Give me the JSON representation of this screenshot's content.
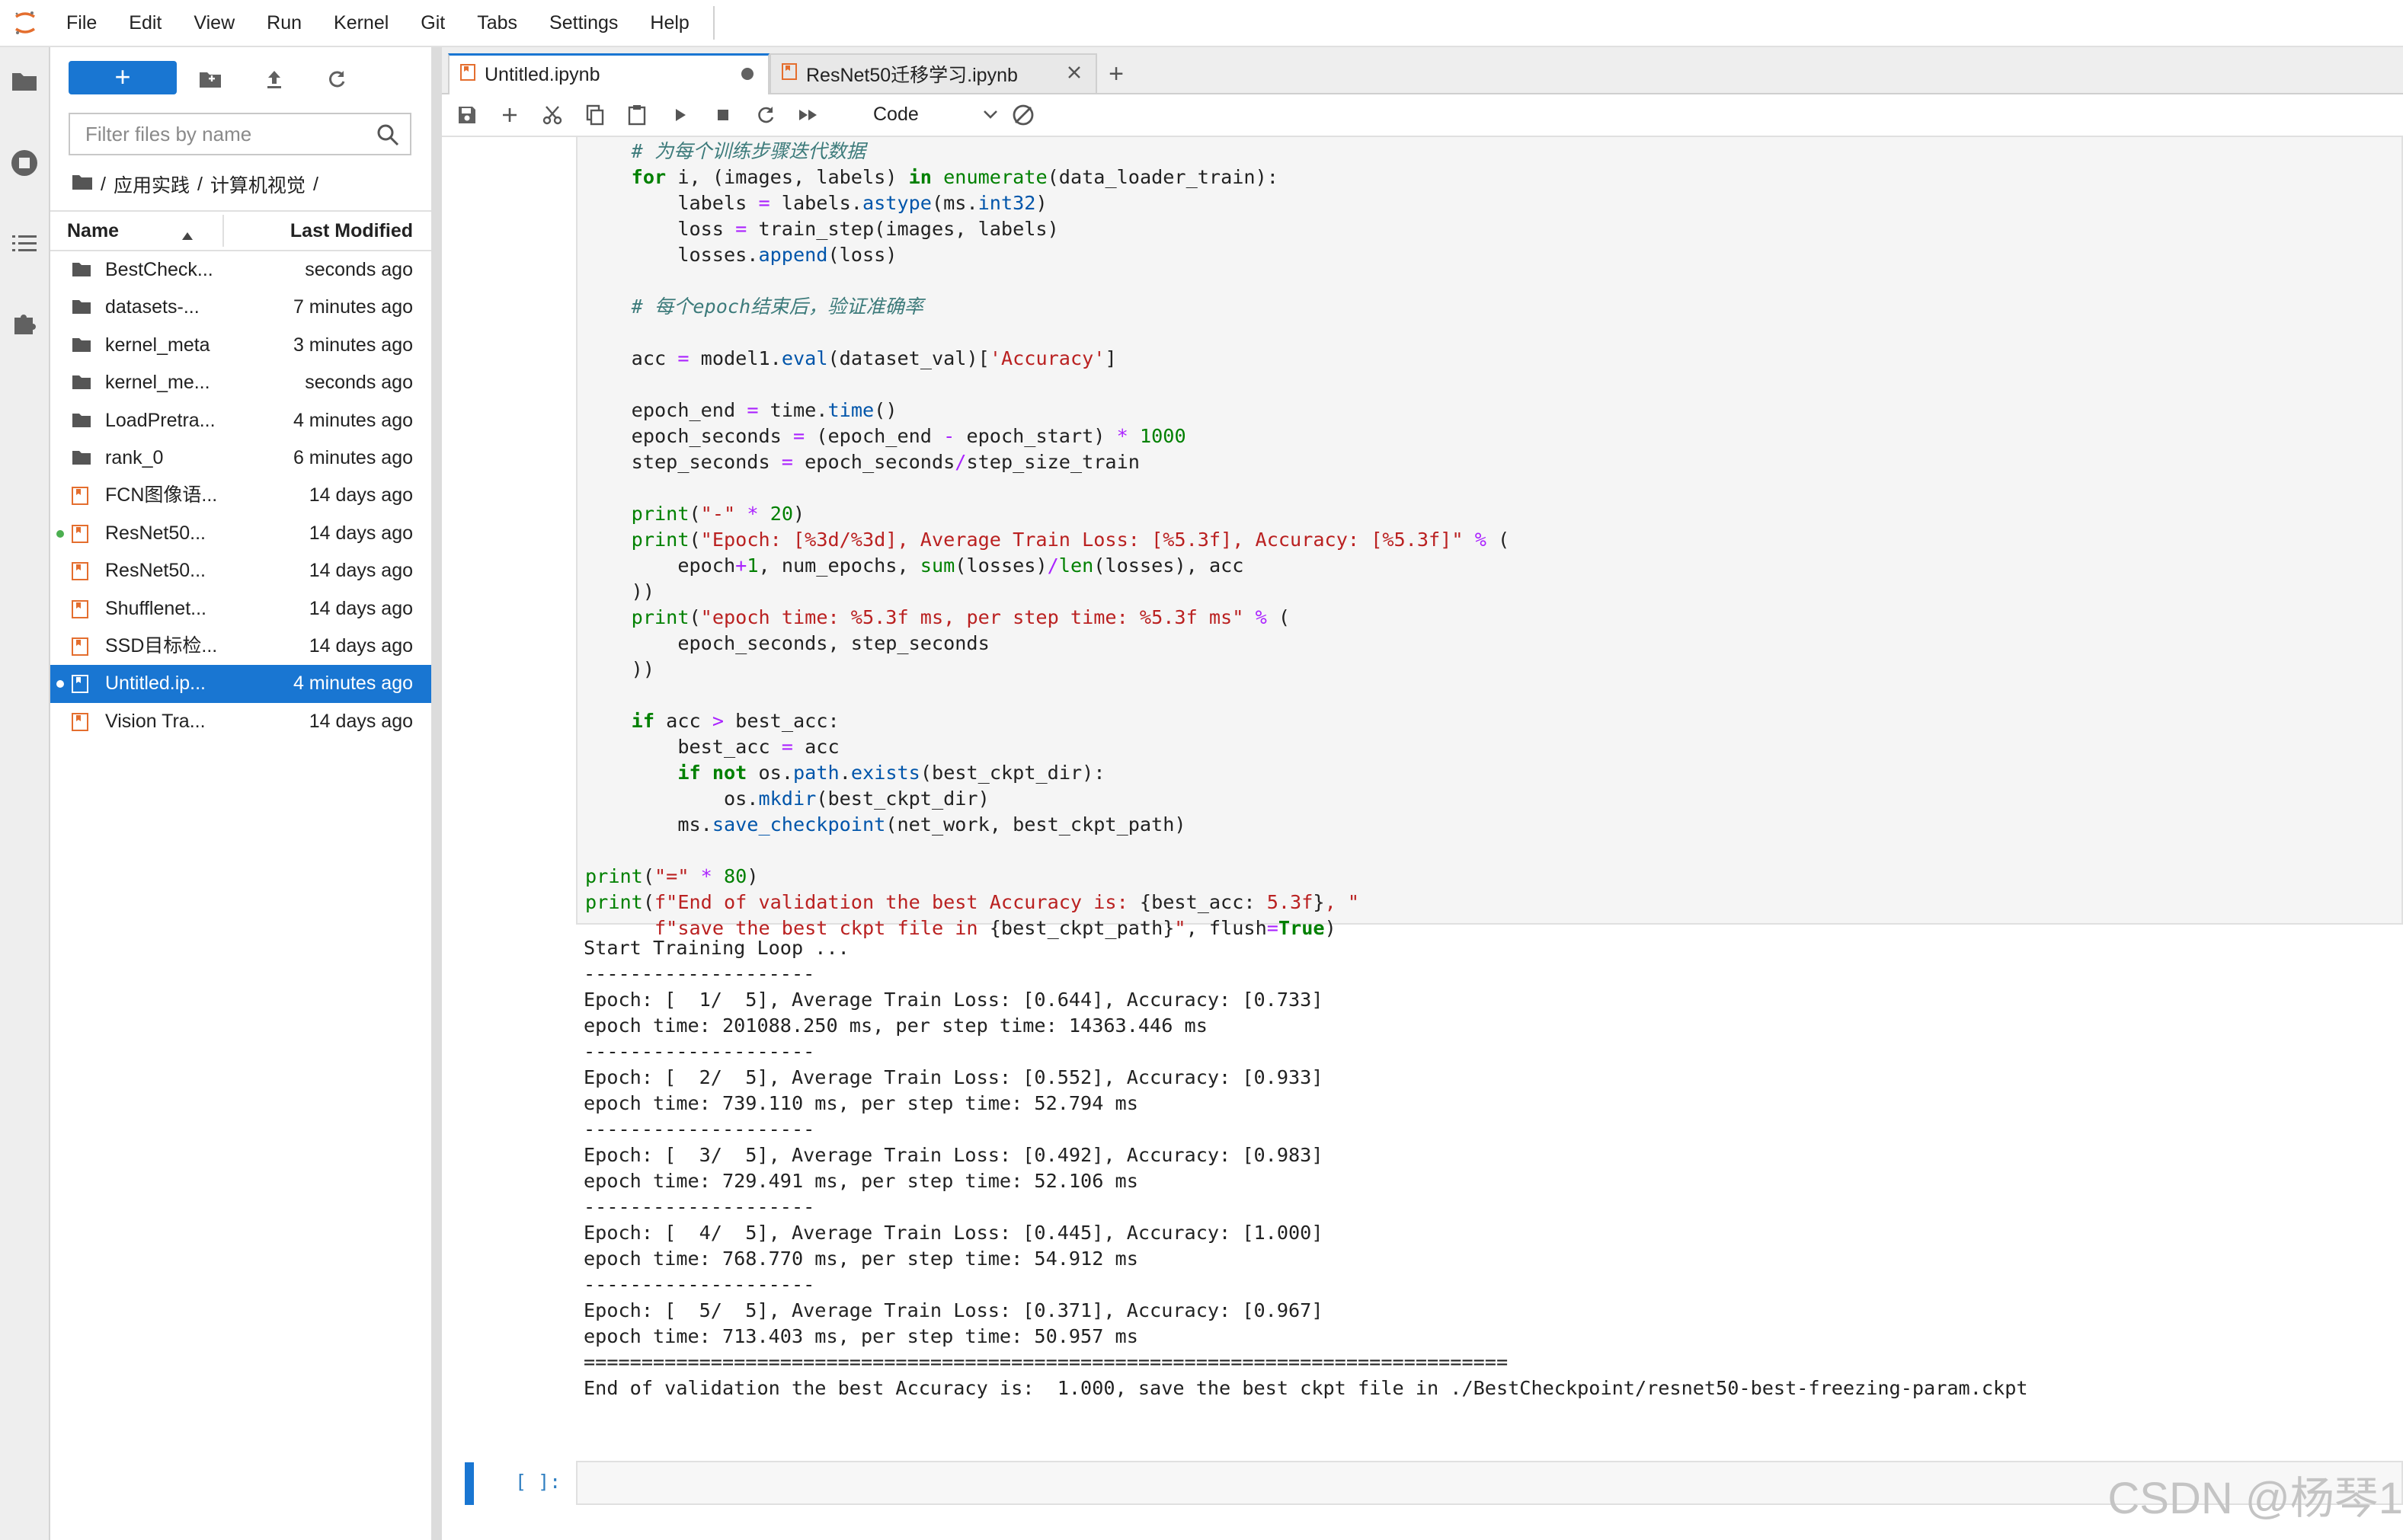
{
  "menu": [
    "File",
    "Edit",
    "View",
    "Run",
    "Kernel",
    "Git",
    "Tabs",
    "Settings",
    "Help"
  ],
  "file_browser": {
    "new_button_label": "+",
    "filter_placeholder": "Filter files by name",
    "breadcrumb": [
      "/",
      "应用实践",
      "/",
      "计算机视觉",
      "/"
    ],
    "columns": {
      "name": "Name",
      "modified": "Last Modified"
    },
    "items": [
      {
        "name": "BestCheck...",
        "modified": "seconds ago",
        "type": "folder",
        "running": false,
        "selected": false
      },
      {
        "name": "datasets-...",
        "modified": "7 minutes ago",
        "type": "folder",
        "running": false,
        "selected": false
      },
      {
        "name": "kernel_meta",
        "modified": "3 minutes ago",
        "type": "folder",
        "running": false,
        "selected": false
      },
      {
        "name": "kernel_me...",
        "modified": "seconds ago",
        "type": "folder",
        "running": false,
        "selected": false
      },
      {
        "name": "LoadPretra...",
        "modified": "4 minutes ago",
        "type": "folder",
        "running": false,
        "selected": false
      },
      {
        "name": "rank_0",
        "modified": "6 minutes ago",
        "type": "folder",
        "running": false,
        "selected": false
      },
      {
        "name": "FCN图像语...",
        "modified": "14 days ago",
        "type": "notebook",
        "running": false,
        "selected": false
      },
      {
        "name": "ResNet50...",
        "modified": "14 days ago",
        "type": "notebook",
        "running": true,
        "selected": false
      },
      {
        "name": "ResNet50...",
        "modified": "14 days ago",
        "type": "notebook",
        "running": false,
        "selected": false
      },
      {
        "name": "Shufflenet...",
        "modified": "14 days ago",
        "type": "notebook",
        "running": false,
        "selected": false
      },
      {
        "name": "SSD目标检...",
        "modified": "14 days ago",
        "type": "notebook",
        "running": false,
        "selected": false
      },
      {
        "name": "Untitled.ip...",
        "modified": "4 minutes ago",
        "type": "notebook",
        "running": true,
        "selected": true
      },
      {
        "name": "Vision Tra...",
        "modified": "14 days ago",
        "type": "notebook",
        "running": false,
        "selected": false
      }
    ]
  },
  "tabs": [
    {
      "label": "Untitled.ipynb",
      "active": true,
      "unsaved": true
    },
    {
      "label": "ResNet50迁移学习.ipynb",
      "active": false,
      "unsaved": false
    }
  ],
  "tab_add_label": "+",
  "toolbar": {
    "cell_type": "Code"
  },
  "code_lines": [
    [
      [
        "    ",
        ""
      ],
      [
        "# 为每个训练步骤迭代数据",
        "cm"
      ]
    ],
    [
      [
        "    ",
        ""
      ],
      [
        "for",
        "kw"
      ],
      [
        " i, (images, labels) ",
        ""
      ],
      [
        "in",
        "kw"
      ],
      [
        " ",
        ""
      ],
      [
        "enumerate",
        "bi"
      ],
      [
        "(data_loader_train):",
        ""
      ]
    ],
    [
      [
        "        labels ",
        ""
      ],
      [
        "=",
        "op"
      ],
      [
        " labels.",
        ""
      ],
      [
        "astype",
        "fn"
      ],
      [
        "(ms.",
        ""
      ],
      [
        "int32",
        "fn"
      ],
      [
        ")",
        ""
      ]
    ],
    [
      [
        "        loss ",
        ""
      ],
      [
        "=",
        "op"
      ],
      [
        " train_step(images, labels)",
        ""
      ]
    ],
    [
      [
        "        losses.",
        ""
      ],
      [
        "append",
        "fn"
      ],
      [
        "(loss)",
        ""
      ]
    ],
    [
      [
        "",
        ""
      ]
    ],
    [
      [
        "    ",
        ""
      ],
      [
        "# 每个epoch结束后，验证准确率",
        "cm"
      ]
    ],
    [
      [
        "",
        ""
      ]
    ],
    [
      [
        "    acc ",
        ""
      ],
      [
        "=",
        "op"
      ],
      [
        " model1.",
        ""
      ],
      [
        "eval",
        "fn"
      ],
      [
        "(dataset_val)[",
        ""
      ],
      [
        "'Accuracy'",
        "st"
      ],
      [
        "]",
        ""
      ]
    ],
    [
      [
        "",
        ""
      ]
    ],
    [
      [
        "    epoch_end ",
        ""
      ],
      [
        "=",
        "op"
      ],
      [
        " time.",
        ""
      ],
      [
        "time",
        "fn"
      ],
      [
        "()",
        ""
      ]
    ],
    [
      [
        "    epoch_seconds ",
        ""
      ],
      [
        "=",
        "op"
      ],
      [
        " (epoch_end ",
        ""
      ],
      [
        "-",
        "op"
      ],
      [
        " epoch_start) ",
        ""
      ],
      [
        "*",
        "op"
      ],
      [
        " ",
        ""
      ],
      [
        "1000",
        "nm"
      ]
    ],
    [
      [
        "    step_seconds ",
        ""
      ],
      [
        "=",
        "op"
      ],
      [
        " epoch_seconds",
        ""
      ],
      [
        "/",
        "op"
      ],
      [
        "step_size_train",
        ""
      ]
    ],
    [
      [
        "",
        ""
      ]
    ],
    [
      [
        "    ",
        ""
      ],
      [
        "print",
        "bi"
      ],
      [
        "(",
        ""
      ],
      [
        "\"-\"",
        "st"
      ],
      [
        " ",
        ""
      ],
      [
        "*",
        "op"
      ],
      [
        " ",
        ""
      ],
      [
        "20",
        "nm"
      ],
      [
        ")",
        ""
      ]
    ],
    [
      [
        "    ",
        ""
      ],
      [
        "print",
        "bi"
      ],
      [
        "(",
        ""
      ],
      [
        "\"Epoch: [%3d/%3d], Average Train Loss: [%5.3f], Accuracy: [%5.3f]\"",
        "st"
      ],
      [
        " ",
        ""
      ],
      [
        "%",
        "op"
      ],
      [
        " (",
        ""
      ]
    ],
    [
      [
        "        epoch",
        ""
      ],
      [
        "+",
        "op"
      ],
      [
        "1",
        "nm"
      ],
      [
        ", num_epochs, ",
        ""
      ],
      [
        "sum",
        "bi"
      ],
      [
        "(losses)",
        ""
      ],
      [
        "/",
        "op"
      ],
      [
        "len",
        "bi"
      ],
      [
        "(losses), acc",
        ""
      ]
    ],
    [
      [
        "    ))",
        ""
      ]
    ],
    [
      [
        "    ",
        ""
      ],
      [
        "print",
        "bi"
      ],
      [
        "(",
        ""
      ],
      [
        "\"epoch time: %5.3f ms, per step time: %5.3f ms\"",
        "st"
      ],
      [
        " ",
        ""
      ],
      [
        "%",
        "op"
      ],
      [
        " (",
        ""
      ]
    ],
    [
      [
        "        epoch_seconds, step_seconds",
        ""
      ]
    ],
    [
      [
        "    ))",
        ""
      ]
    ],
    [
      [
        "",
        ""
      ]
    ],
    [
      [
        "    ",
        ""
      ],
      [
        "if",
        "kw"
      ],
      [
        " acc ",
        ""
      ],
      [
        ">",
        "op"
      ],
      [
        " best_acc:",
        ""
      ]
    ],
    [
      [
        "        best_acc ",
        ""
      ],
      [
        "=",
        "op"
      ],
      [
        " acc",
        ""
      ]
    ],
    [
      [
        "        ",
        ""
      ],
      [
        "if",
        "kw"
      ],
      [
        " ",
        ""
      ],
      [
        "not",
        "kw"
      ],
      [
        " os.",
        ""
      ],
      [
        "path",
        "fn"
      ],
      [
        ".",
        ""
      ],
      [
        "exists",
        "fn"
      ],
      [
        "(best_ckpt_dir):",
        ""
      ]
    ],
    [
      [
        "            os.",
        ""
      ],
      [
        "mkdir",
        "fn"
      ],
      [
        "(best_ckpt_dir)",
        ""
      ]
    ],
    [
      [
        "        ms.",
        ""
      ],
      [
        "save_checkpoint",
        "fn"
      ],
      [
        "(net_work, best_ckpt_path)",
        ""
      ]
    ],
    [
      [
        "",
        ""
      ]
    ],
    [
      [
        "print",
        "bi"
      ],
      [
        "(",
        ""
      ],
      [
        "\"=\"",
        "st"
      ],
      [
        " ",
        ""
      ],
      [
        "*",
        "op"
      ],
      [
        " ",
        ""
      ],
      [
        "80",
        "nm"
      ],
      [
        ")",
        ""
      ]
    ],
    [
      [
        "print",
        "bi"
      ],
      [
        "(",
        ""
      ],
      [
        "f\"End of validation the best Accuracy is: ",
        "st"
      ],
      [
        "{best_acc: ",
        ""
      ],
      [
        "5.3f",
        "st"
      ],
      [
        "}",
        ""
      ],
      [
        ", \"",
        "st"
      ]
    ],
    [
      [
        "      ",
        ""
      ],
      [
        "f\"save the best ckpt file in ",
        "st"
      ],
      [
        "{best_ckpt_path}",
        ""
      ],
      [
        "\"",
        "st"
      ],
      [
        ", flush",
        ""
      ],
      [
        "=",
        "op"
      ],
      [
        "True",
        "kc"
      ],
      [
        ")",
        ""
      ]
    ]
  ],
  "output_lines": [
    "Start Training Loop ...",
    "--------------------",
    "Epoch: [  1/  5], Average Train Loss: [0.644], Accuracy: [0.733]",
    "epoch time: 201088.250 ms, per step time: 14363.446 ms",
    "--------------------",
    "Epoch: [  2/  5], Average Train Loss: [0.552], Accuracy: [0.933]",
    "epoch time: 739.110 ms, per step time: 52.794 ms",
    "--------------------",
    "Epoch: [  3/  5], Average Train Loss: [0.492], Accuracy: [0.983]",
    "epoch time: 729.491 ms, per step time: 52.106 ms",
    "--------------------",
    "Epoch: [  4/  5], Average Train Loss: [0.445], Accuracy: [1.000]",
    "epoch time: 768.770 ms, per step time: 54.912 ms",
    "--------------------",
    "Epoch: [  5/  5], Average Train Loss: [0.371], Accuracy: [0.967]",
    "epoch time: 713.403 ms, per step time: 50.957 ms",
    "================================================================================",
    "End of validation the best Accuracy is:  1.000, save the best ckpt file in ./BestCheckpoint/resnet50-best-freezing-param.ckpt"
  ],
  "empty_cell_prompt": "[ ]:",
  "watermark": "CSDN @杨琴1",
  "colors": {
    "accent": "#1976d2",
    "notebook_icon": "#e46e2e",
    "running_dot": "#4caf50"
  }
}
